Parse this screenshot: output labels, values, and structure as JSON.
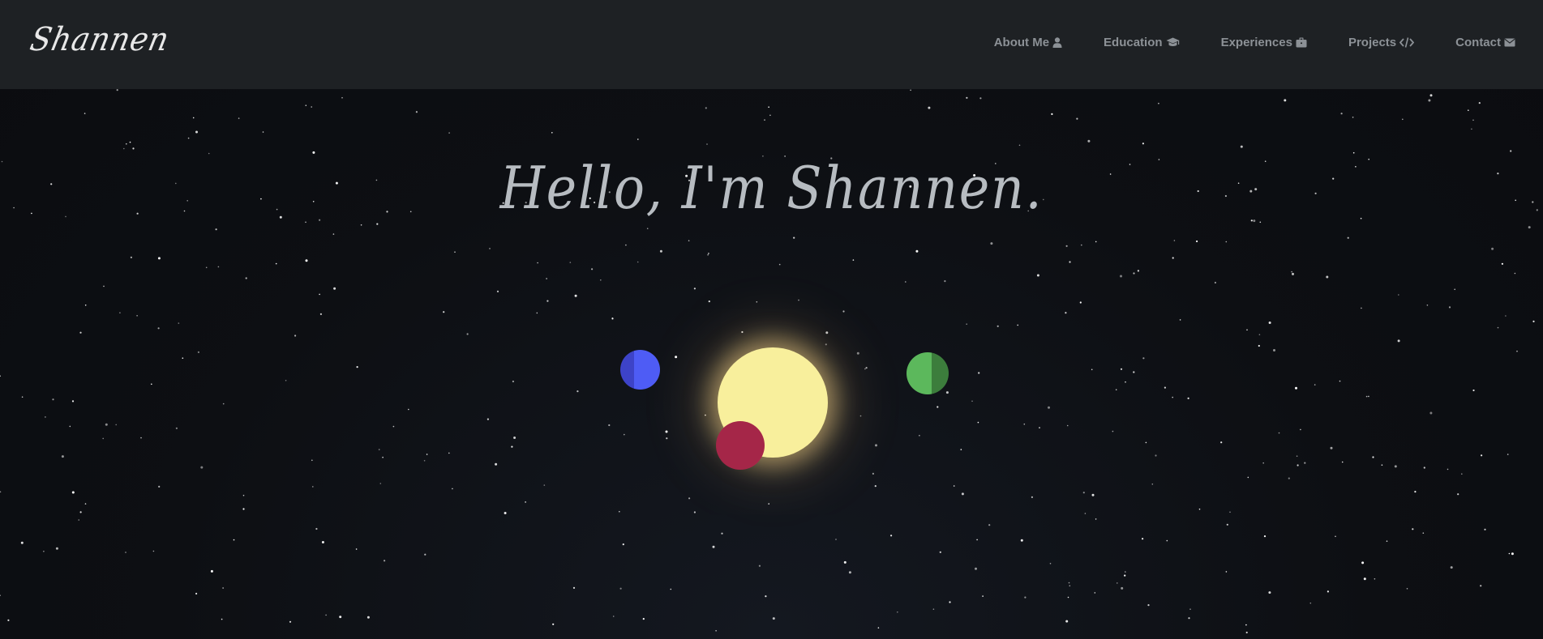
{
  "navbar": {
    "brand": "Shannen",
    "links": [
      {
        "label": "About Me",
        "icon": "user-icon"
      },
      {
        "label": "Education",
        "icon": "graduation-cap-icon"
      },
      {
        "label": "Experiences",
        "icon": "briefcase-icon"
      },
      {
        "label": "Projects",
        "icon": "code-icon"
      },
      {
        "label": "Contact",
        "icon": "envelope-icon"
      }
    ]
  },
  "hero": {
    "title": "Hello, I'm Shannen."
  },
  "solar_system": {
    "sun_color": "#f8ef9c",
    "planets": [
      {
        "name": "blue",
        "colors": [
          "#3d43c8",
          "#4e5cf5"
        ]
      },
      {
        "name": "green",
        "colors": [
          "#5cb85c",
          "#3c7d3c"
        ]
      },
      {
        "name": "red",
        "colors": [
          "#a52648",
          "#c72b52"
        ]
      }
    ]
  },
  "colors": {
    "navbar_bg": "#1e2124",
    "page_bg": "#0c0d11",
    "nav_text": "#8c9196",
    "title_text": "#b7bcc1"
  }
}
